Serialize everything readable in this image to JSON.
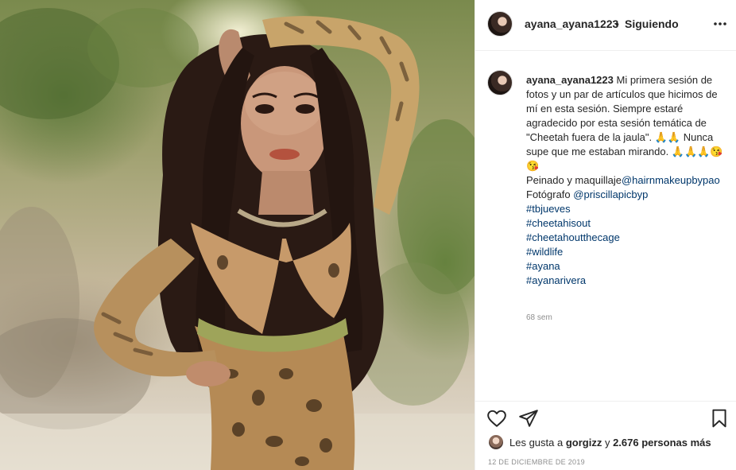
{
  "post": {
    "image_alt": "Mujer con vestido estampado de guepardo posando al aire libre"
  },
  "header": {
    "username": "ayana_ayana1223",
    "separator": "•",
    "follow_label": "Siguiendo",
    "more_icon": "more-horizontal-icon"
  },
  "caption": {
    "username": "ayana_ayana1223",
    "text": "Mi primera sesión de fotos y un par de artículos que hicimos de mí en esta sesión. Siempre estaré agradecido por esta sesión temática de \"Cheetah fuera de la jaula\". 🙏🙏 Nunca supe que me estaban mirando. 🙏🙏🙏😘😘",
    "credit_hair_label": "Peinado y maquillaje",
    "credit_hair_handle": "@hairnmakeupbypao",
    "credit_photo_label": "Fotógrafo ",
    "credit_photo_handle": "@priscillapicbyp",
    "hashtags": [
      "#tbjueves",
      "#cheetahisout",
      "#cheetahoutthecage",
      "#wildlife",
      "#ayana",
      "#ayanarivera"
    ],
    "time_ago": "68 sem"
  },
  "actions": {
    "like_icon": "heart-icon",
    "share_icon": "paper-plane-icon",
    "save_icon": "bookmark-icon"
  },
  "likes": {
    "prefix": "Les gusta a ",
    "user": "gorgizz",
    "middle": " y ",
    "count": "2.676 personas más"
  },
  "date": "12 DE DICIEMBRE DE 2019"
}
